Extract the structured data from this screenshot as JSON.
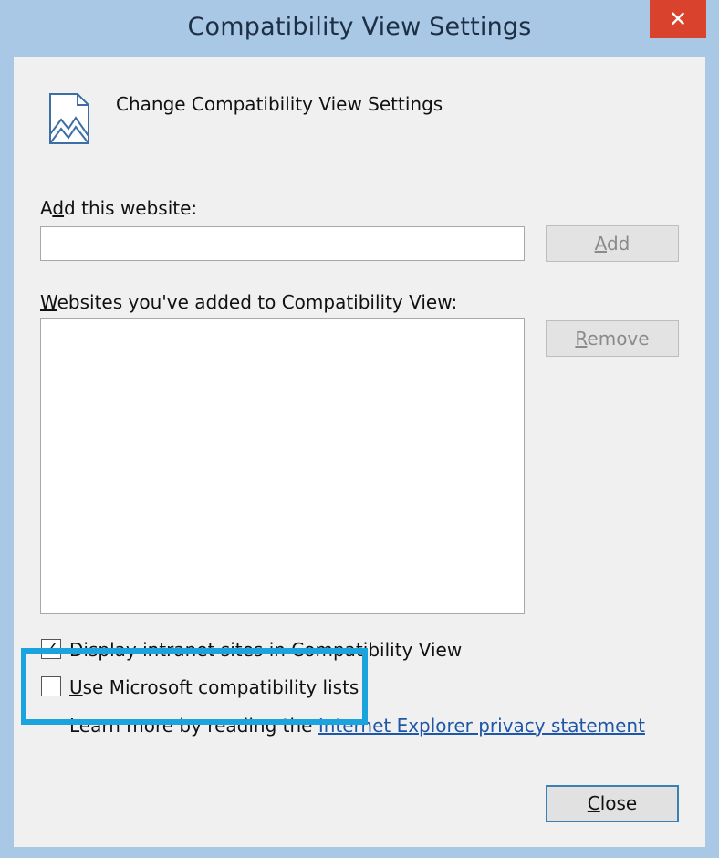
{
  "window": {
    "title": "Compatibility View Settings",
    "close_glyph": "✕"
  },
  "header": {
    "icon": "document-image-icon",
    "text": "Change Compatibility View Settings"
  },
  "add_section": {
    "label_prefix": "A",
    "label_underlined": "d",
    "label_suffix": "d this website:",
    "input_value": "",
    "add_button_underlined": "A",
    "add_button_suffix": "dd"
  },
  "list_section": {
    "label_underlined": "W",
    "label_suffix": "ebsites you've added to Compatibility View:",
    "items": [],
    "remove_button_underlined": "R",
    "remove_button_suffix": "emove"
  },
  "options": {
    "display_intranet": {
      "label": "Display intranet sites in Compatibility View",
      "checked": true
    },
    "use_ms_lists": {
      "label_underlined": "U",
      "label_suffix": "se Microsoft compatibility lists",
      "checked": false
    }
  },
  "privacy": {
    "prefix": "Learn more by reading the ",
    "link": "Internet Explorer privacy statement"
  },
  "footer": {
    "close_underlined": "C",
    "close_suffix": "lose"
  },
  "colors": {
    "frame": "#a9c8e6",
    "close_red": "#d9432e",
    "highlight": "#1aa3dd",
    "link": "#1f57a8"
  }
}
